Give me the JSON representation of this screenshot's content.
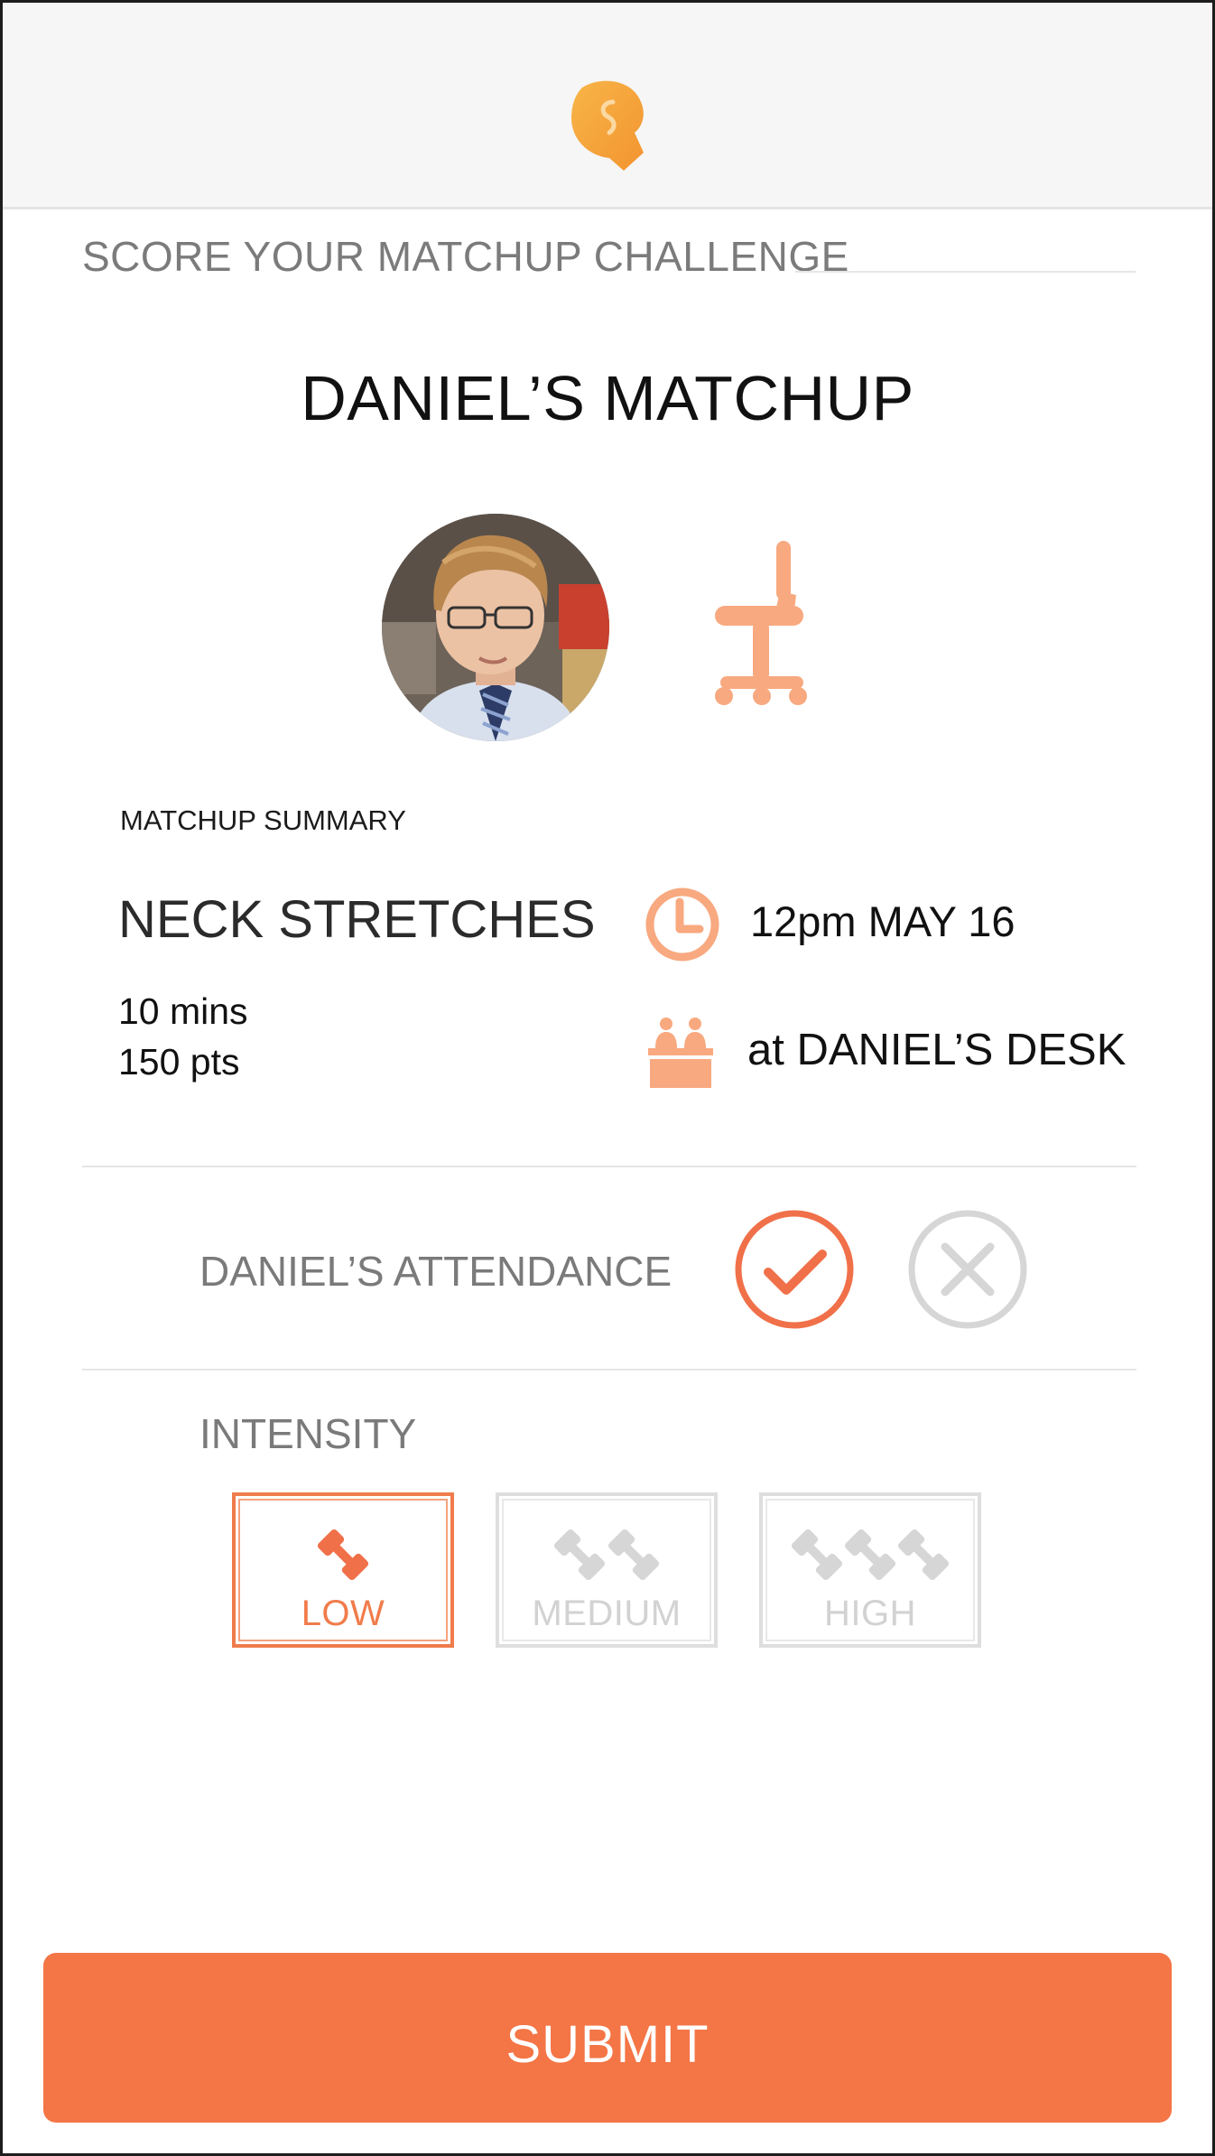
{
  "header": {
    "logo_icon": "boxing-glove-icon"
  },
  "section_title": "SCORE YOUR MATCHUP CHALLENGE",
  "page_title": "DANIEL’S MATCHUP",
  "matchup": {
    "avatar_icon": "user-photo",
    "type_icon": "office-chair-icon",
    "summary_label": "MATCHUP SUMMARY",
    "activity": "NECK STRETCHES",
    "duration": "10 mins",
    "points": "150 pts",
    "time_icon": "clock-icon",
    "time": "12pm MAY 16",
    "location_icon": "desk-icon",
    "location": "at DANIEL’S DESK"
  },
  "attendance": {
    "label": "DANIEL’S ATTENDANCE",
    "options": [
      {
        "name": "yes",
        "icon": "checkmark-icon",
        "selected": true
      },
      {
        "name": "no",
        "icon": "x-icon",
        "selected": false
      }
    ]
  },
  "intensity": {
    "label": "INTENSITY",
    "options": [
      {
        "label": "LOW",
        "icon": "dumbbell-icon",
        "count": 1,
        "selected": true
      },
      {
        "label": "MEDIUM",
        "icon": "dumbbell-icon",
        "count": 2,
        "selected": false
      },
      {
        "label": "HIGH",
        "icon": "dumbbell-icon",
        "count": 3,
        "selected": false
      }
    ]
  },
  "submit_label": "SUBMIT",
  "colors": {
    "accent": "#f47545",
    "accent_light": "#f5a17d",
    "inactive": "#d2d2d2",
    "header_bg": "#f5f6f5"
  }
}
